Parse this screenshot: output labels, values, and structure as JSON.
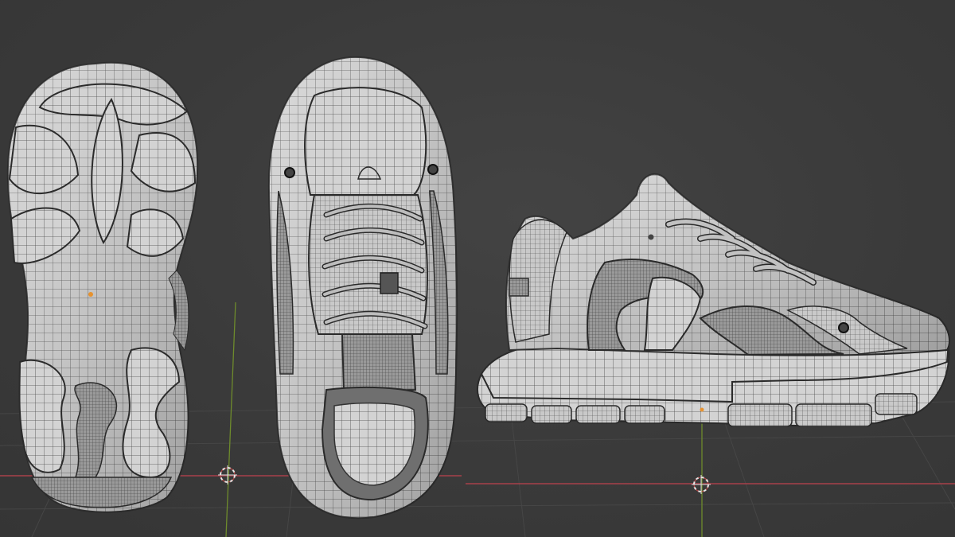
{
  "viewport": {
    "background": "#3b3b3b",
    "grid_color": "#474747",
    "x_axis_color": "#a8414a",
    "y_axis_color": "#6e8b2c"
  },
  "objects": [
    {
      "name": "shoe-sole-bottom-view",
      "view": "bottom"
    },
    {
      "name": "shoe-top-view",
      "view": "top"
    },
    {
      "name": "shoe-side-view",
      "view": "side"
    }
  ],
  "mesh": {
    "surface_color": "#d2d2d2",
    "shadow_color": "#8f8f8f",
    "wire_color": "#3d3d3d"
  },
  "cursors": [
    {
      "name": "3d-cursor-icon"
    },
    {
      "name": "3d-cursor-icon"
    }
  ]
}
